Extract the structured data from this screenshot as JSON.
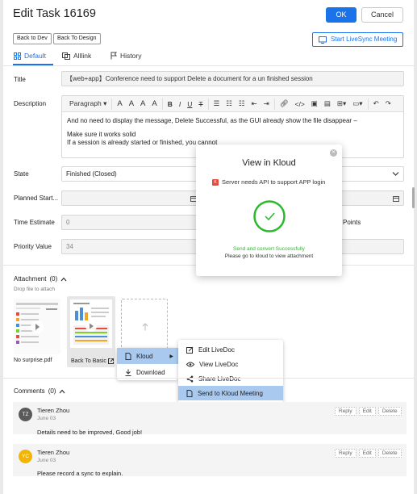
{
  "header": {
    "title": "Edit Task 16169",
    "ok_label": "OK",
    "cancel_label": "Cancel",
    "back_to_dev_label": "Back to Dev",
    "back_to_design_label": "Back To Design",
    "start_livesync_label": "Start  LiveSync Meeting"
  },
  "tabs": [
    {
      "label": "Default",
      "icon": "grid-icon",
      "active": true
    },
    {
      "label": "Alllink",
      "icon": "link-doc-icon",
      "active": false
    },
    {
      "label": "History",
      "icon": "flag-icon",
      "active": false
    }
  ],
  "form": {
    "title_label": "Title",
    "title_value": "【web+app】Conference need to support Delete a document for a un finished session",
    "description_label": "Description",
    "toolbar": {
      "paragraph_label": "Paragraph",
      "font_sizes": [
        "A",
        "A",
        "A",
        "A"
      ],
      "bold": "B",
      "italic": "I",
      "underline": "U",
      "strike": "T"
    },
    "description_lines": [
      "And no need to display the message, Delete Successful, as the GUI already show the file disappear –",
      "Make sure it works solid",
      "If a session is already started or finished, you cannot"
    ],
    "state_label": "State",
    "state_value": "Finished (Closed)",
    "planned_start_label": "Planned Start...",
    "time_estimate_label": "Time Estimate",
    "time_estimate_value": "0",
    "points_label": "Points",
    "priority_label": "Priority Value",
    "priority_value": "34"
  },
  "attachment": {
    "header_label": "Attachment",
    "count": "(0)",
    "drop_hint": "Drop file to attach",
    "items": [
      {
        "name": "No surprise.pdf"
      },
      {
        "name": "Back To Basic"
      }
    ]
  },
  "context_menu": {
    "kloud_label": "Kloud",
    "download_label": "Download"
  },
  "submenu": {
    "items": [
      {
        "label": "Edit LiveDoc",
        "icon": "edit-icon"
      },
      {
        "label": "View LiveDoc",
        "icon": "eye-icon"
      },
      {
        "label": "Share LiveDoc",
        "icon": "share-icon"
      },
      {
        "label": "Send to Kloud Meeting",
        "icon": "doc-icon",
        "highlighted": true
      }
    ]
  },
  "comments": {
    "header_label": "Comments",
    "count": "(0)",
    "actions": [
      "Reply",
      "Edit",
      "Delete"
    ],
    "items": [
      {
        "initials": "TZ",
        "author": "Tieren Zhou",
        "date": "June 03",
        "text": "Details need to be improved, Good job!",
        "avatar_color": "#5a5a5a"
      },
      {
        "initials": "YC",
        "author": "Tieren Zhou",
        "date": "June 03",
        "text": "Please record a sync to explain.",
        "avatar_color": "#f5b400"
      }
    ]
  },
  "modal": {
    "title": "View in Kloud",
    "notice": "Server needs API to support APP login",
    "success_text": "Send and convert Successfully",
    "hint_text": "Please go to kloud to view attachment",
    "accent_color": "#2db92d"
  },
  "colors": {
    "primary": "#1a73e8",
    "highlight": "#aac9ee"
  }
}
